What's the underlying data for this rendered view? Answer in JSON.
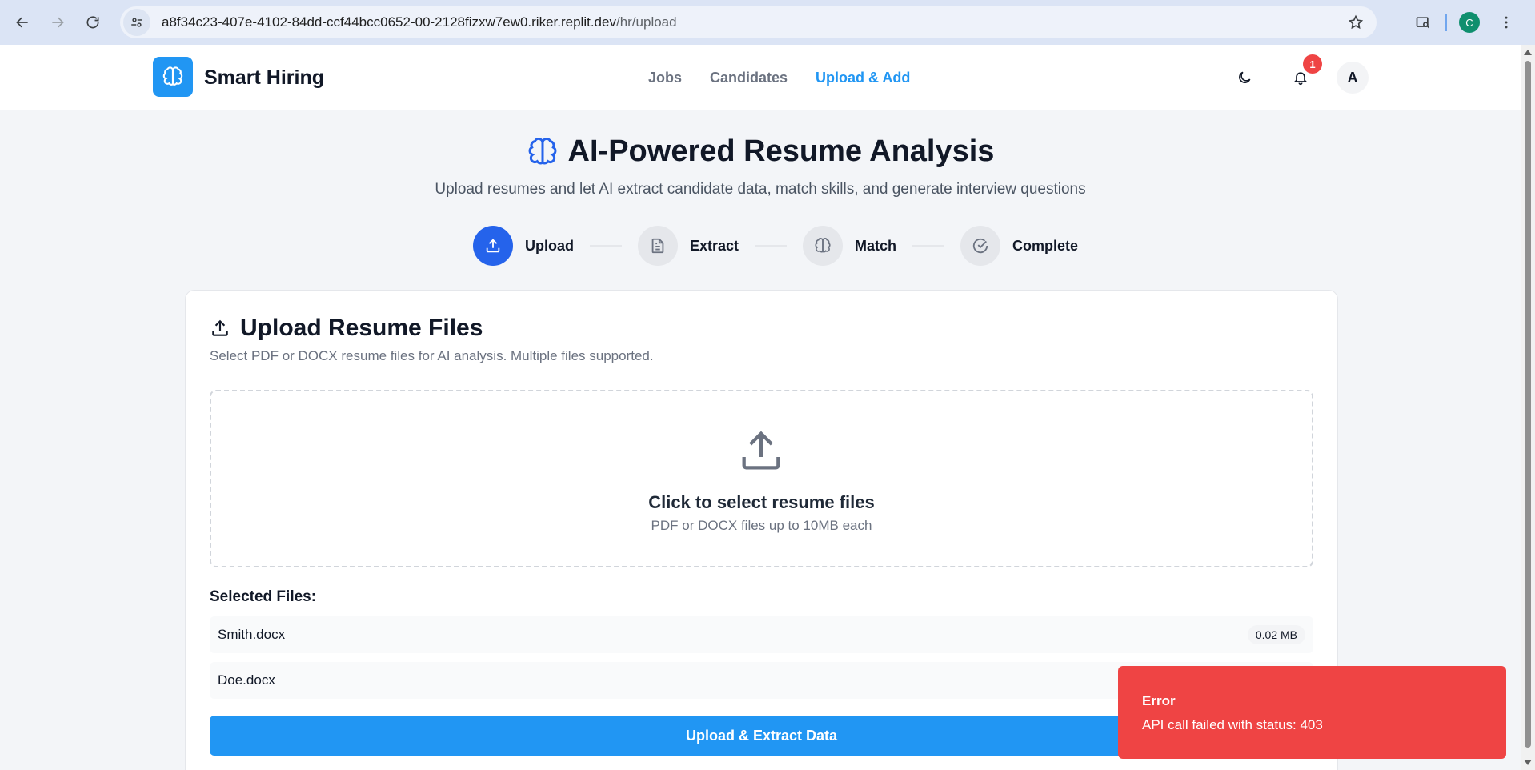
{
  "browser": {
    "url_host": "a8f34c23-407e-4102-84dd-ccf44bcc0652-00-2128fizxw7ew0.riker.replit.dev",
    "url_path": "/hr/upload",
    "profile_initial": "C"
  },
  "header": {
    "brand": "Smart Hiring",
    "nav": [
      "Jobs",
      "Candidates",
      "Upload & Add"
    ],
    "active_nav": "Upload & Add",
    "notification_count": "1",
    "avatar_initial": "A"
  },
  "hero": {
    "title": "AI-Powered Resume Analysis",
    "subtitle": "Upload resumes and let AI extract candidate data, match skills, and generate interview questions"
  },
  "steps": [
    {
      "label": "Upload",
      "icon": "upload-icon",
      "active": true
    },
    {
      "label": "Extract",
      "icon": "document-icon",
      "active": false
    },
    {
      "label": "Match",
      "icon": "brain-icon",
      "active": false
    },
    {
      "label": "Complete",
      "icon": "check-circle-icon",
      "active": false
    }
  ],
  "card": {
    "title": "Upload Resume Files",
    "description": "Select PDF or DOCX resume files for AI analysis. Multiple files supported.",
    "dropzone_title": "Click to select resume files",
    "dropzone_sub": "PDF or DOCX files up to 10MB each",
    "selected_title": "Selected Files:",
    "files": [
      {
        "name": "Smith.docx",
        "size": "0.02 MB"
      },
      {
        "name": "Doe.docx",
        "size": ""
      }
    ],
    "button": "Upload & Extract Data"
  },
  "toast": {
    "title": "Error",
    "message": "API call failed with status: 403",
    "color": "#ef4444"
  },
  "colors": {
    "primary": "#2196f3",
    "step_active": "#2563eb"
  }
}
